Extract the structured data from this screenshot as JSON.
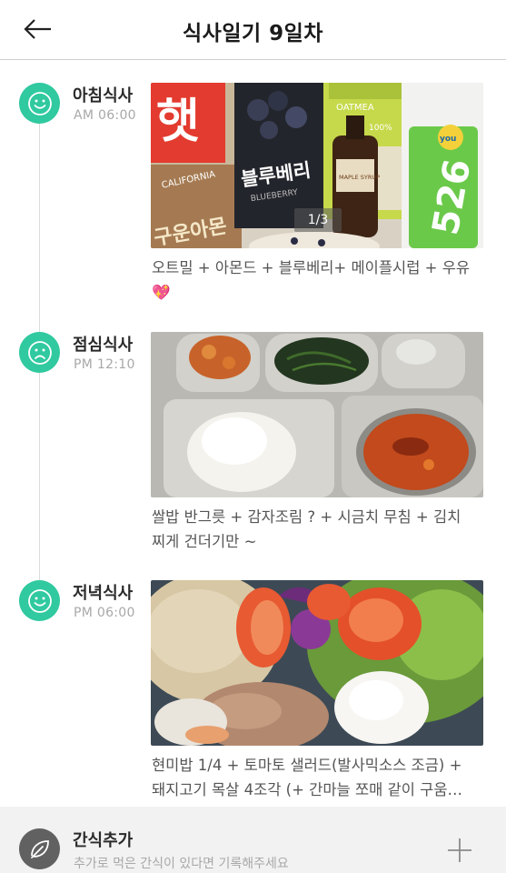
{
  "header": {
    "title": "식사일기 9일차"
  },
  "meals": [
    {
      "name": "아침식사",
      "time": "AM 06:00",
      "mood": "happy",
      "photo_counter": "1/3",
      "caption_line1": "오트밀 + 아몬드 + 블루베리+ 메이플시럽 + 우유",
      "caption_emoji": "💖"
    },
    {
      "name": "점심식사",
      "time": "PM 12:10",
      "mood": "sad",
      "caption_line1": "쌀밥 반그릇 + 감자조림 ? + 시금치 무침 + 김치",
      "caption_line2": "찌게 건더기만 ~"
    },
    {
      "name": "저녁식사",
      "time": "PM 06:00",
      "mood": "happy",
      "caption_line1": "현미밥 1/4 + 토마토 샐러드(발사믹소스 조금)  +",
      "caption_line2": "돼지고기 목살 4조각 (+ 간마늘 쪼매 같이 구움…"
    }
  ],
  "snack": {
    "title": "간식추가",
    "subtitle": "추가로 먹은 간식이 있다면 기록해주세요"
  },
  "breakfast_package_text": {
    "bag1_big": "햇",
    "bag1_small": "CALIFORNIA",
    "bag1_bottom": "구운아몬",
    "bag2": "블루베리",
    "bag2_small": "BLUEBERRY",
    "oat": "OATMEA",
    "oat_pct": "100%",
    "syrup": "MAPLE SYRUP",
    "milk": "526",
    "milk_brand": "you"
  },
  "colors": {
    "mood_icon": "#30c9a0",
    "snack_icon": "#616161",
    "divider": "#cfcfcf"
  },
  "icons": {
    "back": "arrow-left-icon",
    "happy": "smile-icon",
    "sad": "frown-icon",
    "snack": "leaf-icon",
    "add": "plus-icon"
  }
}
